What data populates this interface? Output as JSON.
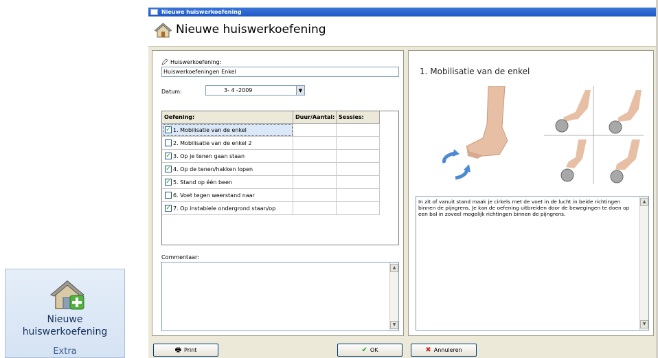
{
  "ribbon": {
    "label_line1": "Nieuwe",
    "label_line2": "huiswerkoefening",
    "group": "Extra"
  },
  "dialog": {
    "window_title": "Nieuwe huiswerkoefening",
    "header_title": "Nieuwe huiswerkoefening",
    "homework_label": "Huiswerkoefening:",
    "homework_value": "Huiswerkoefeningen Enkel",
    "date_label": "Datum:",
    "date_value": "3- 4 -2009",
    "columns": [
      "Oefening:",
      "Duur/Aantal:",
      "Sessies:"
    ],
    "exercises": [
      {
        "label": "1. Mobilisatie van de enkel",
        "checked": true
      },
      {
        "label": "2. Mobilisatie van de enkel 2",
        "checked": false
      },
      {
        "label": "3. Op je tenen gaan staan",
        "checked": true
      },
      {
        "label": "4. Op de tenen/hakken lopen",
        "checked": true
      },
      {
        "label": "5. Stand op één been",
        "checked": true
      },
      {
        "label": "6. Voet tegen weerstand naar",
        "checked": false
      },
      {
        "label": "7. Op instabiele ondergrond staan/op",
        "checked": true
      }
    ],
    "comment_label": "Commentaar:",
    "exercise_title": "1. Mobilisatie van de enkel",
    "description": "In zit of vanuit stand maak je cirkels met de voet in de lucht in beide richtingen binnen de pijngrens. Je kan de oefening uitbreiden door de bewegingen te doen op een bal in zoveel mogelijk richtingen binnen de pijngrens.",
    "buttons": {
      "print": "Print",
      "ok": "OK",
      "cancel": "Annuleren"
    }
  },
  "colors": {
    "accent": "#1f57c8",
    "check": "#21a121",
    "cancel": "#d22a1e"
  }
}
